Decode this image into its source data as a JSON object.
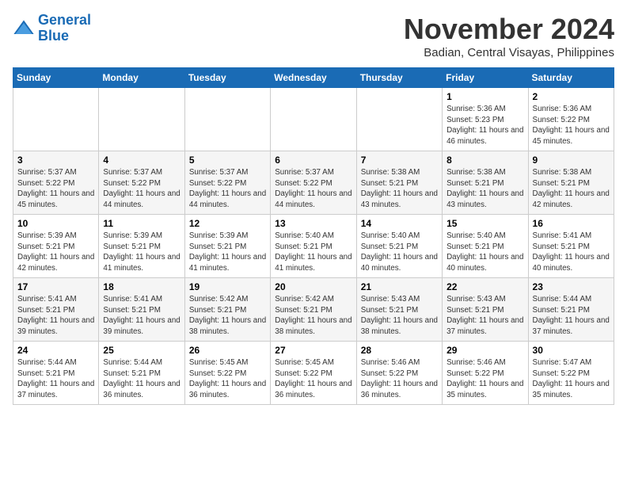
{
  "header": {
    "logo_line1": "General",
    "logo_line2": "Blue",
    "month_year": "November 2024",
    "location": "Badian, Central Visayas, Philippines"
  },
  "weekdays": [
    "Sunday",
    "Monday",
    "Tuesday",
    "Wednesday",
    "Thursday",
    "Friday",
    "Saturday"
  ],
  "weeks": [
    [
      {
        "day": "",
        "info": ""
      },
      {
        "day": "",
        "info": ""
      },
      {
        "day": "",
        "info": ""
      },
      {
        "day": "",
        "info": ""
      },
      {
        "day": "",
        "info": ""
      },
      {
        "day": "1",
        "info": "Sunrise: 5:36 AM\nSunset: 5:23 PM\nDaylight: 11 hours and 46 minutes."
      },
      {
        "day": "2",
        "info": "Sunrise: 5:36 AM\nSunset: 5:22 PM\nDaylight: 11 hours and 45 minutes."
      }
    ],
    [
      {
        "day": "3",
        "info": "Sunrise: 5:37 AM\nSunset: 5:22 PM\nDaylight: 11 hours and 45 minutes."
      },
      {
        "day": "4",
        "info": "Sunrise: 5:37 AM\nSunset: 5:22 PM\nDaylight: 11 hours and 44 minutes."
      },
      {
        "day": "5",
        "info": "Sunrise: 5:37 AM\nSunset: 5:22 PM\nDaylight: 11 hours and 44 minutes."
      },
      {
        "day": "6",
        "info": "Sunrise: 5:37 AM\nSunset: 5:22 PM\nDaylight: 11 hours and 44 minutes."
      },
      {
        "day": "7",
        "info": "Sunrise: 5:38 AM\nSunset: 5:21 PM\nDaylight: 11 hours and 43 minutes."
      },
      {
        "day": "8",
        "info": "Sunrise: 5:38 AM\nSunset: 5:21 PM\nDaylight: 11 hours and 43 minutes."
      },
      {
        "day": "9",
        "info": "Sunrise: 5:38 AM\nSunset: 5:21 PM\nDaylight: 11 hours and 42 minutes."
      }
    ],
    [
      {
        "day": "10",
        "info": "Sunrise: 5:39 AM\nSunset: 5:21 PM\nDaylight: 11 hours and 42 minutes."
      },
      {
        "day": "11",
        "info": "Sunrise: 5:39 AM\nSunset: 5:21 PM\nDaylight: 11 hours and 41 minutes."
      },
      {
        "day": "12",
        "info": "Sunrise: 5:39 AM\nSunset: 5:21 PM\nDaylight: 11 hours and 41 minutes."
      },
      {
        "day": "13",
        "info": "Sunrise: 5:40 AM\nSunset: 5:21 PM\nDaylight: 11 hours and 41 minutes."
      },
      {
        "day": "14",
        "info": "Sunrise: 5:40 AM\nSunset: 5:21 PM\nDaylight: 11 hours and 40 minutes."
      },
      {
        "day": "15",
        "info": "Sunrise: 5:40 AM\nSunset: 5:21 PM\nDaylight: 11 hours and 40 minutes."
      },
      {
        "day": "16",
        "info": "Sunrise: 5:41 AM\nSunset: 5:21 PM\nDaylight: 11 hours and 40 minutes."
      }
    ],
    [
      {
        "day": "17",
        "info": "Sunrise: 5:41 AM\nSunset: 5:21 PM\nDaylight: 11 hours and 39 minutes."
      },
      {
        "day": "18",
        "info": "Sunrise: 5:41 AM\nSunset: 5:21 PM\nDaylight: 11 hours and 39 minutes."
      },
      {
        "day": "19",
        "info": "Sunrise: 5:42 AM\nSunset: 5:21 PM\nDaylight: 11 hours and 38 minutes."
      },
      {
        "day": "20",
        "info": "Sunrise: 5:42 AM\nSunset: 5:21 PM\nDaylight: 11 hours and 38 minutes."
      },
      {
        "day": "21",
        "info": "Sunrise: 5:43 AM\nSunset: 5:21 PM\nDaylight: 11 hours and 38 minutes."
      },
      {
        "day": "22",
        "info": "Sunrise: 5:43 AM\nSunset: 5:21 PM\nDaylight: 11 hours and 37 minutes."
      },
      {
        "day": "23",
        "info": "Sunrise: 5:44 AM\nSunset: 5:21 PM\nDaylight: 11 hours and 37 minutes."
      }
    ],
    [
      {
        "day": "24",
        "info": "Sunrise: 5:44 AM\nSunset: 5:21 PM\nDaylight: 11 hours and 37 minutes."
      },
      {
        "day": "25",
        "info": "Sunrise: 5:44 AM\nSunset: 5:21 PM\nDaylight: 11 hours and 36 minutes."
      },
      {
        "day": "26",
        "info": "Sunrise: 5:45 AM\nSunset: 5:22 PM\nDaylight: 11 hours and 36 minutes."
      },
      {
        "day": "27",
        "info": "Sunrise: 5:45 AM\nSunset: 5:22 PM\nDaylight: 11 hours and 36 minutes."
      },
      {
        "day": "28",
        "info": "Sunrise: 5:46 AM\nSunset: 5:22 PM\nDaylight: 11 hours and 36 minutes."
      },
      {
        "day": "29",
        "info": "Sunrise: 5:46 AM\nSunset: 5:22 PM\nDaylight: 11 hours and 35 minutes."
      },
      {
        "day": "30",
        "info": "Sunrise: 5:47 AM\nSunset: 5:22 PM\nDaylight: 11 hours and 35 minutes."
      }
    ]
  ]
}
